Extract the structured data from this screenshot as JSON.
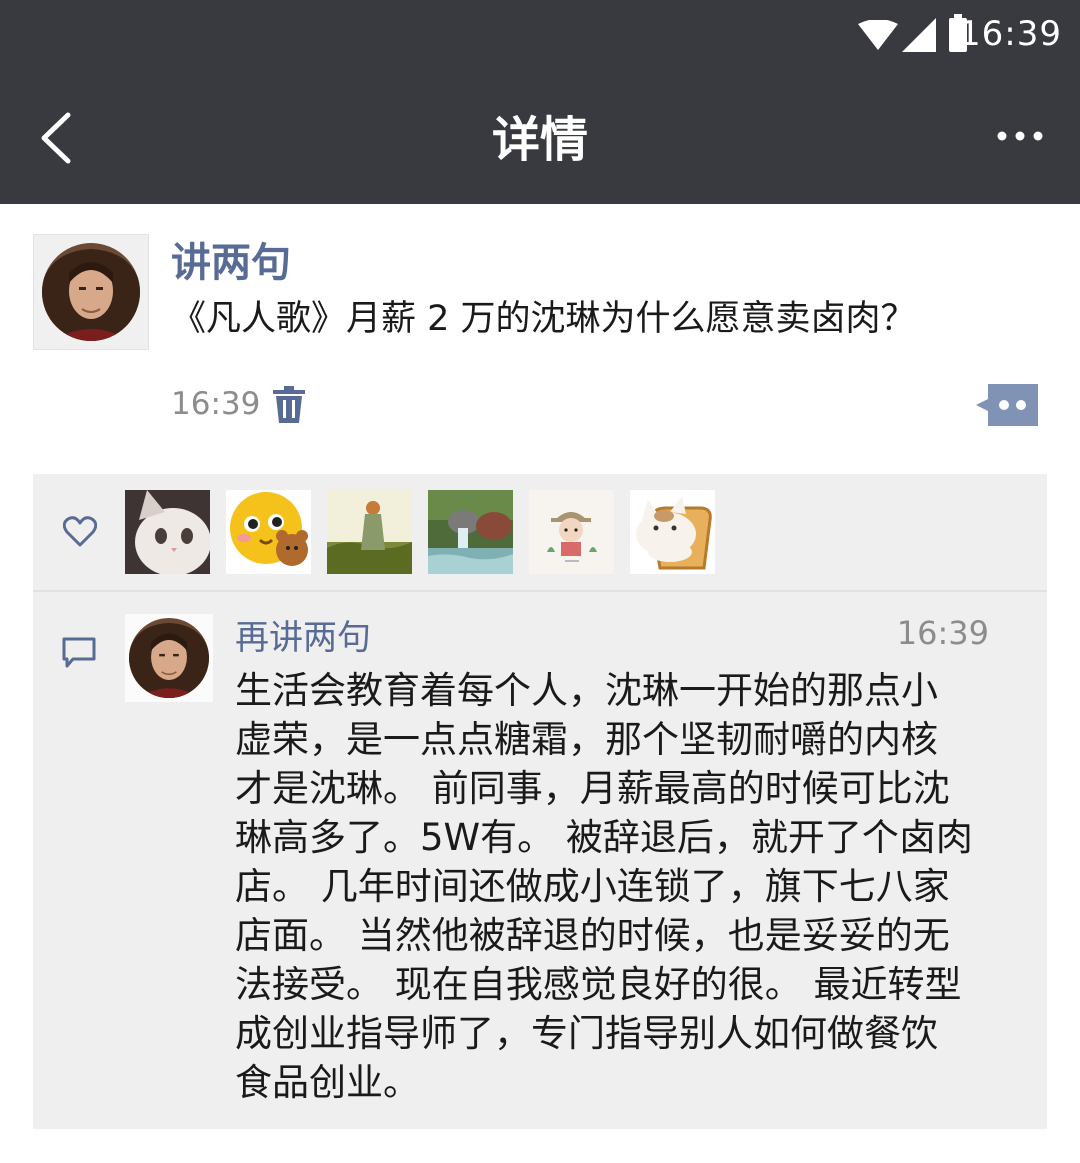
{
  "status_bar": {
    "time": "16:39"
  },
  "header": {
    "title": "详情",
    "back_icon": "chevron-left-icon",
    "more_icon": "ellipsis-icon"
  },
  "post": {
    "author": "讲两句",
    "text": "《凡人歌》月薪 2 万的沈琳为什么愿意卖卤肉？",
    "time": "16:39"
  },
  "likes": {
    "icon": "heart-icon",
    "users": [
      "cat-avatar",
      "emoji-bear-avatar",
      "girl-field-avatar",
      "waterfall-avatar",
      "cartoon-boy-avatar",
      "cat-toast-avatar"
    ]
  },
  "comments": [
    {
      "author": "再讲两句",
      "time": "16:39",
      "text": "生活会教育着每个人，沈琳一开始的那点小\n虚荣，是一点点糖霜，那个坚韧耐嚼的内核\n才是沈琳。 前同事，月薪最高的时候可比沈\n琳高多了。5W有。 被辞退后，就开了个卤肉\n店。 几年时间还做成小连锁了，旗下七八家\n店面。 当然他被辞退的时候，也是妥妥的无\n法接受。 现在自我感觉良好的很。 最近转型\n成创业指导师了，专门指导别人如何做餐饮\n食品创业。"
    }
  ],
  "colors": {
    "bar": "#393a3f",
    "link": "#576b95",
    "panel": "#efefef"
  }
}
